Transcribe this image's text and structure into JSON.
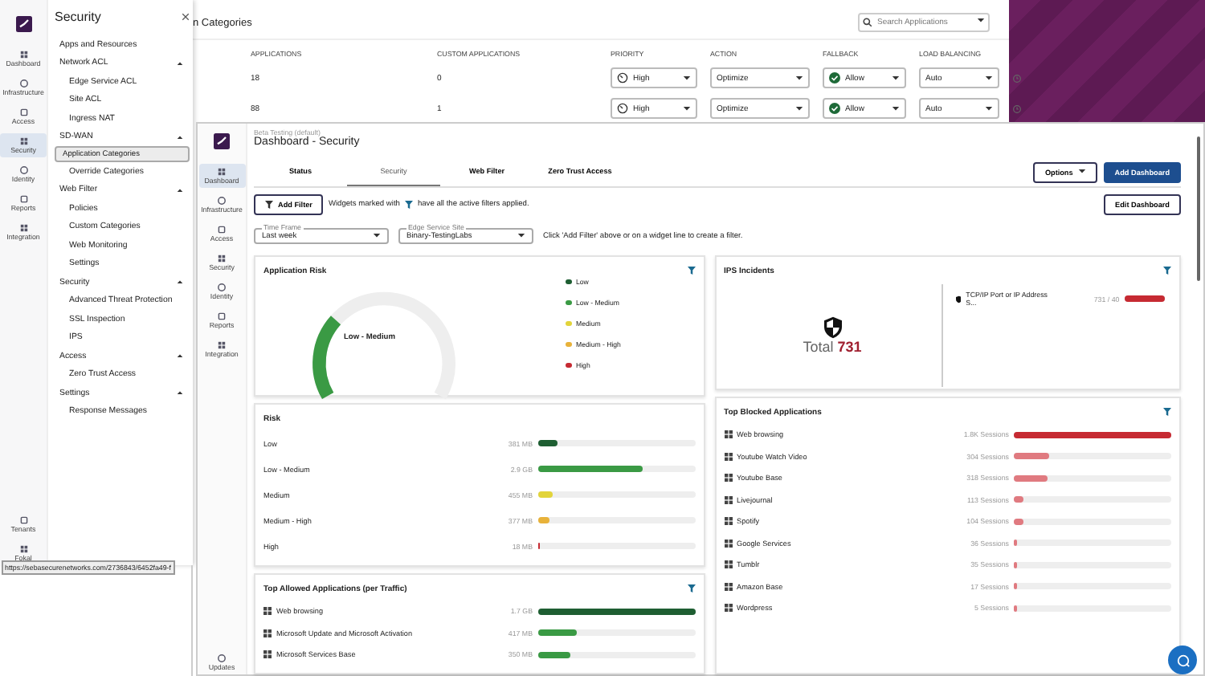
{
  "back_window": {
    "title": "n Categories",
    "search": {
      "placeholder": "Search Applications"
    },
    "columns": [
      "APPLICATIONS",
      "CUSTOM APPLICATIONS",
      "PRIORITY",
      "ACTION",
      "FALLBACK",
      "LOAD BALANCING"
    ],
    "rows": [
      {
        "applications": "18",
        "custom": "0",
        "priority": "High",
        "action": "Optimize",
        "fallback": "Allow",
        "load_balancing": "Auto"
      },
      {
        "applications": "88",
        "custom": "1",
        "priority": "High",
        "action": "Optimize",
        "fallback": "Allow",
        "load_balancing": "Auto"
      }
    ]
  },
  "left_app": {
    "rail": [
      {
        "label": "Dashboard",
        "selected": false
      },
      {
        "label": "Infrastructure",
        "selected": false
      },
      {
        "label": "Access",
        "selected": false
      },
      {
        "label": "Security",
        "selected": true
      },
      {
        "label": "Identity",
        "selected": false
      },
      {
        "label": "Reports",
        "selected": false
      },
      {
        "label": "Integration",
        "selected": false
      }
    ],
    "rail_bottom": [
      "Tenants",
      "Fokal"
    ],
    "menu": {
      "title": "Security",
      "items": [
        {
          "label": "Apps and Resources",
          "selected": false
        },
        {
          "label": "Network ACL",
          "expanded": true,
          "children": [
            {
              "label": "Edge Service ACL",
              "selected": false
            },
            {
              "label": "Site ACL",
              "selected": false
            },
            {
              "label": "Ingress NAT",
              "selected": false
            }
          ]
        },
        {
          "label": "SD-WAN",
          "expanded": true,
          "children": [
            {
              "label": "Application Categories",
              "selected": true
            },
            {
              "label": "Override Categories",
              "selected": false
            }
          ]
        },
        {
          "label": "Web Filter",
          "expanded": true,
          "children": [
            {
              "label": "Policies",
              "selected": false
            },
            {
              "label": "Custom Categories",
              "selected": false
            },
            {
              "label": "Web Monitoring",
              "selected": false
            },
            {
              "label": "Settings",
              "selected": false
            }
          ]
        },
        {
          "label": "Security",
          "expanded": true,
          "children": [
            {
              "label": "Advanced Threat Protection",
              "selected": false
            },
            {
              "label": "SSL Inspection",
              "selected": false
            },
            {
              "label": "IPS",
              "selected": false
            }
          ]
        },
        {
          "label": "Access",
          "expanded": true,
          "children": [
            {
              "label": "Zero Trust Access",
              "selected": false
            }
          ]
        },
        {
          "label": "Settings",
          "expanded": true,
          "children": [
            {
              "label": "Response Messages",
              "selected": false
            }
          ]
        }
      ]
    },
    "status_url": "https://sebasecurenetworks.com/2736843/6452fa49-f"
  },
  "dashboard": {
    "rail": [
      {
        "label": "Dashboard",
        "selected": true
      },
      {
        "label": "Infrastructure",
        "selected": false
      },
      {
        "label": "Access",
        "selected": false
      },
      {
        "label": "Security",
        "selected": false
      },
      {
        "label": "Identity",
        "selected": false
      },
      {
        "label": "Reports",
        "selected": false
      },
      {
        "label": "Integration",
        "selected": false
      }
    ],
    "rail_bottom": [
      "Updates"
    ],
    "workspace": "Beta Testing (default)",
    "title": "Dashboard - Security",
    "tabs": [
      {
        "label": "Status",
        "selected": false
      },
      {
        "label": "Security",
        "selected": true
      },
      {
        "label": "Web Filter",
        "selected": false
      },
      {
        "label": "Zero Trust Access",
        "selected": false
      }
    ],
    "buttons": {
      "options": "Options",
      "add": "Add Dashboard",
      "add_filter": "Add Filter",
      "edit": "Edit Dashboard"
    },
    "filter_note_before": "Widgets marked with",
    "filter_note_after": "have all the active filters applied.",
    "selects": [
      {
        "label": "Time Frame",
        "value": "Last week"
      },
      {
        "label": "Edge Service Site",
        "value": "Binary-TestingLabs"
      }
    ],
    "filter_hint": "Click 'Add Filter' above or on a widget line to create a filter.",
    "app_risk": {
      "title": "Application Risk",
      "gauge": {
        "label": "Low - Medium",
        "level": 0.3
      },
      "legend": [
        {
          "label": "Low",
          "color": "#1e5e32"
        },
        {
          "label": "Low - Medium",
          "color": "#3a9a44"
        },
        {
          "label": "Medium",
          "color": "#e2d43a"
        },
        {
          "label": "Medium - High",
          "color": "#e8b23a"
        },
        {
          "label": "High",
          "color": "#c62a32"
        }
      ]
    },
    "ips": {
      "title": "IPS Incidents",
      "total_label": "Total",
      "total": "731",
      "items": [
        {
          "name": "TCP/IP Port or IP Address S...",
          "value": "731 / 40",
          "level": 1
        }
      ]
    },
    "risk": {
      "title": "Risk",
      "rows": [
        {
          "name": "Low",
          "value": "381 MB",
          "level": 0.13,
          "color": "#1e5e32"
        },
        {
          "name": "Low - Medium",
          "value": "2.9 GB",
          "level": 0.67,
          "color": "#3a9a44"
        },
        {
          "name": "Medium",
          "value": "455 MB",
          "level": 0.1,
          "color": "#e2d43a"
        },
        {
          "name": "Medium - High",
          "value": "377 MB",
          "level": 0.08,
          "color": "#e8b23a"
        },
        {
          "name": "High",
          "value": "18 MB",
          "level": 0.01,
          "color": "#c62a32"
        }
      ]
    },
    "top_allowed": {
      "title": "Top Allowed Applications (per Traffic)",
      "rows": [
        {
          "name": "Web browsing",
          "value": "1.7 GB",
          "level": 1,
          "color": "#1e5e32"
        },
        {
          "name": "Microsoft Update and Microsoft Activation",
          "value": "417 MB",
          "level": 0.25,
          "color": "#3a9a44"
        },
        {
          "name": "Microsoft Services Base",
          "value": "350 MB",
          "level": 0.21,
          "color": "#3a9a44"
        }
      ]
    },
    "top_blocked": {
      "title": "Top Blocked Applications",
      "rows": [
        {
          "name": "Web browsing",
          "value": "1.8K Sessions",
          "level": 1,
          "color": "#c62a32"
        },
        {
          "name": "Youtube Watch Video",
          "value": "304 Sessions",
          "level": 0.22,
          "color": "#e07a80"
        },
        {
          "name": "Youtube Base",
          "value": "318 Sessions",
          "level": 0.21,
          "color": "#e07a80"
        },
        {
          "name": "Livejournal",
          "value": "113 Sessions",
          "level": 0.06,
          "color": "#e07a80"
        },
        {
          "name": "Spotify",
          "value": "104 Sessions",
          "level": 0.06,
          "color": "#e07a80"
        },
        {
          "name": "Google Services",
          "value": "36 Sessions",
          "level": 0.01,
          "color": "#e07a80"
        },
        {
          "name": "Tumblr",
          "value": "35 Sessions",
          "level": 0.01,
          "color": "#e07a80"
        },
        {
          "name": "Amazon Base",
          "value": "17 Sessions",
          "level": 0.005,
          "color": "#e07a80"
        },
        {
          "name": "Wordpress",
          "value": "5 Sessions",
          "level": 0,
          "color": "#e07a80"
        }
      ]
    }
  }
}
